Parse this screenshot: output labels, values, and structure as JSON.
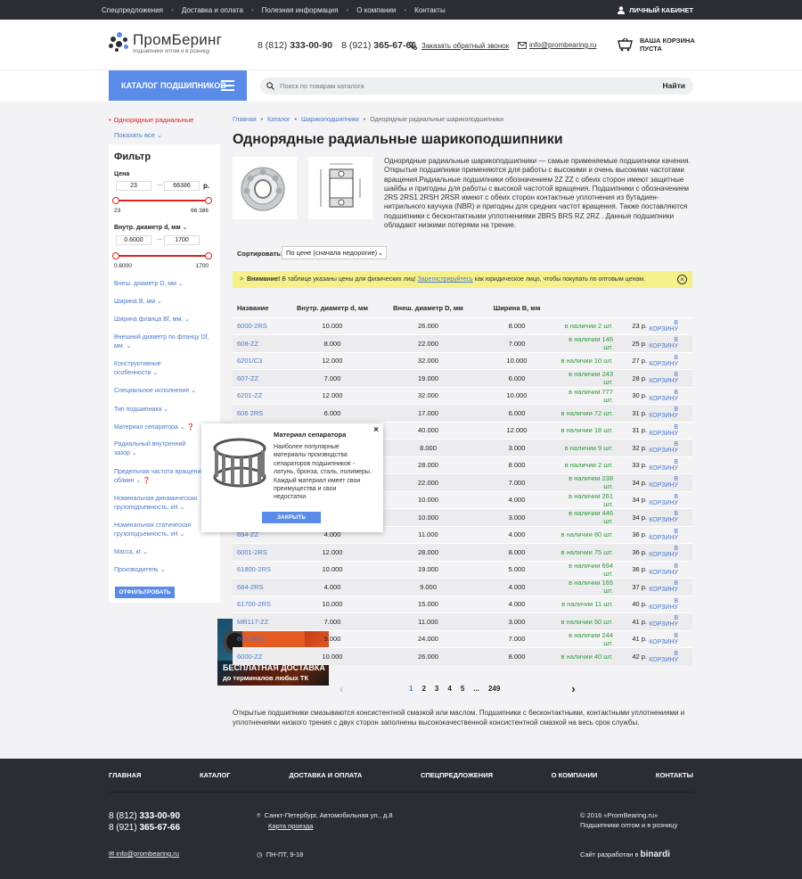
{
  "topbar": {
    "nav": [
      "Спецпредложения",
      "Доставка и оплата",
      "Полезная информация",
      "О компании",
      "Контакты"
    ],
    "account": "ЛИЧНЫЙ КАБИНЕТ"
  },
  "header": {
    "logo_name": "ПромБеринг",
    "logo_tagline": "подшипники оптом и в розницу",
    "phone1_code": "8 (812)",
    "phone1_num": "333-00-90",
    "phone2_code": "8 (921)",
    "phone2_num": "365-67-66",
    "callback": "Заказать обратный звонок",
    "email": "info@prombearing.ru",
    "cart_line1": "ВАША КОРЗИНА",
    "cart_line2": "ПУСТА"
  },
  "catbar": {
    "catalog_button": "КАТАЛОГ ПОДШИПНИКОВ",
    "search_placeholder": "Поиск по товарам каталога",
    "search_button": "Найти"
  },
  "sidebar": {
    "active_item": "Однорядные радиальные",
    "show_all": "Показать все",
    "filter_title": "Фильтр",
    "price_label": "Цена",
    "price_min": "23",
    "price_max": "66386",
    "price_unit": "р.",
    "price_range_min": "23",
    "price_range_max": "66 386",
    "inner_d_label": "Внутр. диаметр d, мм",
    "inner_d_min": "0.6000",
    "inner_d_max": "1700",
    "inner_d_range_min": "0.6000",
    "inner_d_range_max": "1700",
    "links": [
      "Внеш. диаметр D, мм",
      "Ширина B, мм",
      "Ширина фланца Bf, мм.",
      "Внешний диаметр по фланцу Df, мм.",
      "Конструктивные особенности",
      "Специальное исполнение",
      "Тип подшипника",
      "Материал сепаратора",
      "Радиальный внутренний зазор",
      "Предельная частота вращения, об/мин",
      "Номинальная динамическая грузоподъемность, кН",
      "Номинальная статическая грузоподъемность, кН",
      "Масса, кг",
      "Производитель"
    ],
    "filter_button": "ОТФИЛЬТРОВАТЬ",
    "promo_line1": "БЕСПЛАТНАЯ ДОСТАВКА",
    "promo_line2": "до терминалов любых ТК"
  },
  "main": {
    "breadcrumbs": [
      "Главная",
      "Каталог",
      "Шарикоподшипники",
      "Однорядные радиальные шарикоподшипники"
    ],
    "title": "Однорядные радиальные шарикоподшипники",
    "description": "Однорядные радиальные шарикоподшипники — самые применяемые подшипники качения. Открытые подшипники применяются для работы с высокими и очень высокими частотами вращения.Радиальные подшипники обозначением 2Z ZZ с обеих сторон имеют защитные шайбы и пригодны для работы с высокой частотой вращения. Подшипники с обозначением 2RS 2RS1 2RSH 2RSR имеют с обеих сторон контактные уплотнения из бутадиен-нитрильного каучука (NBR) и пригодны для средних частот вращения. Также поставляются подшипники с бесконтактными уплотнениями 2BRS BRS RZ 2RZ . Данные подшипники обладают низкими потерями на трение.",
    "sort_label": "Сортировать:",
    "sort_value": "По цене (сначала недорогие)",
    "warning_bold": "Внимание!",
    "warning_text1": " В таблице указаны цены для физических лиц! ",
    "warning_link": "Зарегистрируйтесь",
    "warning_text2": " как юридическое лицо, чтобы покупать по оптовым ценам.",
    "columns": [
      "Название",
      "Внутр. диаметр d, мм",
      "Внеш. диаметр D, мм",
      "Ширина B, мм"
    ],
    "rows": [
      {
        "name": "6000-2RS",
        "d": "10.000",
        "D": "26.000",
        "B": "8.000",
        "stock": "в наличии 2 шт.",
        "price": "23 р.",
        "btn": "В КОРЗИНУ"
      },
      {
        "name": "608-ZZ",
        "d": "8.000",
        "D": "22.000",
        "B": "7.000",
        "stock": "в наличии 146 шт.",
        "price": "25 р.",
        "btn": "В КОРЗИНУ"
      },
      {
        "name": "6201/C3",
        "d": "12.000",
        "D": "32.000",
        "B": "10.000",
        "stock": "в наличии 10 шт.",
        "price": "27 р.",
        "btn": "В КОРЗИНУ"
      },
      {
        "name": "607-ZZ",
        "d": "7.000",
        "D": "19.000",
        "B": "6.000",
        "stock": "в наличии 243 шт.",
        "price": "28 р.",
        "btn": "В КОРЗИНУ"
      },
      {
        "name": "6201-ZZ",
        "d": "12.000",
        "D": "32.000",
        "B": "10.000",
        "stock": "в наличии 777 шт.",
        "price": "30 р.",
        "btn": "В КОРЗИНУ"
      },
      {
        "name": "606 2RS",
        "d": "6.000",
        "D": "17.000",
        "B": "6.000",
        "stock": "в наличии 72 шт.",
        "price": "31 р.",
        "btn": "В КОРЗИНУ"
      },
      {
        "name": "",
        "d": "",
        "D": "40.000",
        "B": "12.000",
        "stock": "в наличии 18 шт.",
        "price": "31 р.",
        "btn": "В КОРЗИНУ"
      },
      {
        "name": "",
        "d": "",
        "D": "8.000",
        "B": "3.000",
        "stock": "в наличии 9 шт.",
        "price": "32 р.",
        "btn": "В КОРЗИНУ"
      },
      {
        "name": "",
        "d": "",
        "D": "28.000",
        "B": "8.000",
        "stock": "в наличии 2 шт.",
        "price": "33 р.",
        "btn": "В КОРЗИНУ"
      },
      {
        "name": "",
        "d": "",
        "D": "22.000",
        "B": "7.000",
        "stock": "в наличии 238 шт.",
        "price": "34 р.",
        "btn": "В КОРЗИНУ"
      },
      {
        "name": "",
        "d": "",
        "D": "10.000",
        "B": "4.000",
        "stock": "в наличии 261 шт.",
        "price": "34 р.",
        "btn": "В КОРЗИНУ"
      },
      {
        "name": "",
        "d": "",
        "D": "10.000",
        "B": "3.000",
        "stock": "в наличии 446 шт.",
        "price": "34 р.",
        "btn": "В КОРЗИНУ"
      },
      {
        "name": "694-ZZ",
        "d": "4.000",
        "D": "11.000",
        "B": "4.000",
        "stock": "в наличии 80 шт.",
        "price": "36 р.",
        "btn": "В КОРЗИНУ"
      },
      {
        "name": "6001-2RS",
        "d": "12.000",
        "D": "28.000",
        "B": "8.000",
        "stock": "в наличии 75 шт.",
        "price": "36 р.",
        "btn": "В КОРЗИНУ"
      },
      {
        "name": "61800-2RS",
        "d": "10.000",
        "D": "19.000",
        "B": "5.000",
        "stock": "в наличии 694 шт.",
        "price": "36 р.",
        "btn": "В КОРЗИНУ"
      },
      {
        "name": "684-2RS",
        "d": "4.000",
        "D": "9.000",
        "B": "4.000",
        "stock": "в наличии 165 шт.",
        "price": "37 р.",
        "btn": "В КОРЗИНУ"
      },
      {
        "name": "61700-2RS",
        "d": "10.000",
        "D": "15.000",
        "B": "4.000",
        "stock": "в наличии 11 шт.",
        "price": "40 р.",
        "btn": "В КОРЗИНУ"
      },
      {
        "name": "MR117-ZZ",
        "d": "7.000",
        "D": "11.000",
        "B": "3.000",
        "stock": "в наличии 50 шт.",
        "price": "41 р.",
        "btn": "В КОРЗИНУ"
      },
      {
        "name": "609-2RS",
        "d": "9.000",
        "D": "24.000",
        "B": "7.000",
        "stock": "в наличии 244 шт.",
        "price": "41 р.",
        "btn": "В КОРЗИНУ"
      },
      {
        "name": "6000-ZZ",
        "d": "10.000",
        "D": "26.000",
        "B": "8.000",
        "stock": "в наличии 40 шт.",
        "price": "42 р.",
        "btn": "В КОРЗИНУ"
      }
    ],
    "pager": [
      "1",
      "2",
      "3",
      "4",
      "5",
      "...",
      "249"
    ],
    "bottom_text": "Открытые подшипники смазываются консистентной смазкой или маслом. Подшипники с бесконтактными, контактными уплотнениями и уплотнениями низкого трения с двух сторон заполнены высококачественной консистентной смазкой на весь срок службы."
  },
  "popup": {
    "title": "Материал сепаратора",
    "text": "Наиболее популярные материалы производства сепараторов подшипников - латунь, бронза, сталь, полимеры. Каждый материал имеет свои преимущества и свои недостатки.",
    "button": "ЗАКРЫТЬ"
  },
  "footer": {
    "nav": [
      "ГЛАВНАЯ",
      "КАТАЛОГ",
      "ДОСТАВКА И ОПЛАТА",
      "СПЕЦПРЕДЛОЖЕНИЯ",
      "О КОМПАНИИ",
      "КОНТАКТЫ"
    ],
    "phone1_code": "8 (812)",
    "phone1_num": "333-00-90",
    "phone2_code": "8 (921)",
    "phone2_num": "365-67-66",
    "address": "Санкт-Петербург, Автомобильная ул., д.8",
    "map_link": "Карта проезда",
    "email": "info@prombearing.ru",
    "hours": "ПН-ПТ, 9-18",
    "copyright": "© 2016 «PromBearing.ru»",
    "copyright_tag": "Подшипники оптом и в розницу",
    "dev_text": "Сайт разработан в",
    "dev_name": "binardi"
  },
  "colors": {
    "accent": "#5a8be8",
    "link": "#4a79c9",
    "active": "#dd2222",
    "stock": "#2c9a3a",
    "warning_bg": "#f5f08a",
    "dark": "#2b2d34"
  }
}
